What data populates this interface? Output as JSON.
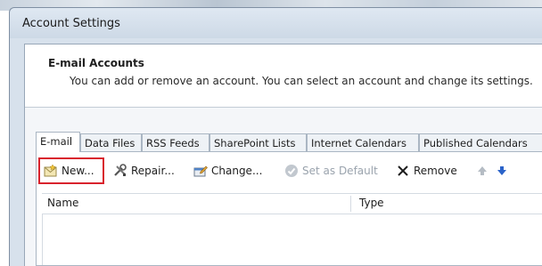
{
  "window": {
    "title": "Account Settings"
  },
  "header": {
    "title": "E-mail Accounts",
    "description": "You can add or remove an account. You can select an account and change its settings."
  },
  "tabs": [
    {
      "label": "E-mail",
      "active": true
    },
    {
      "label": "Data Files"
    },
    {
      "label": "RSS Feeds"
    },
    {
      "label": "SharePoint Lists"
    },
    {
      "label": "Internet Calendars"
    },
    {
      "label": "Published Calendars"
    }
  ],
  "toolbar": {
    "new_label": "New...",
    "repair_label": "Repair...",
    "change_label": "Change...",
    "set_default_label": "Set as Default",
    "remove_label": "Remove",
    "icons": {
      "new": "new-account-envelope-icon",
      "repair": "repair-tools-icon",
      "change": "change-settings-icon",
      "set_default": "check-circle-icon",
      "remove": "x-remove-icon",
      "move_up": "arrow-up-icon",
      "move_down": "arrow-down-icon"
    }
  },
  "list": {
    "columns": [
      "Name",
      "Type"
    ],
    "rows": []
  },
  "colors": {
    "highlight": "#d9232d",
    "arrow_blue": "#2b63c9"
  }
}
